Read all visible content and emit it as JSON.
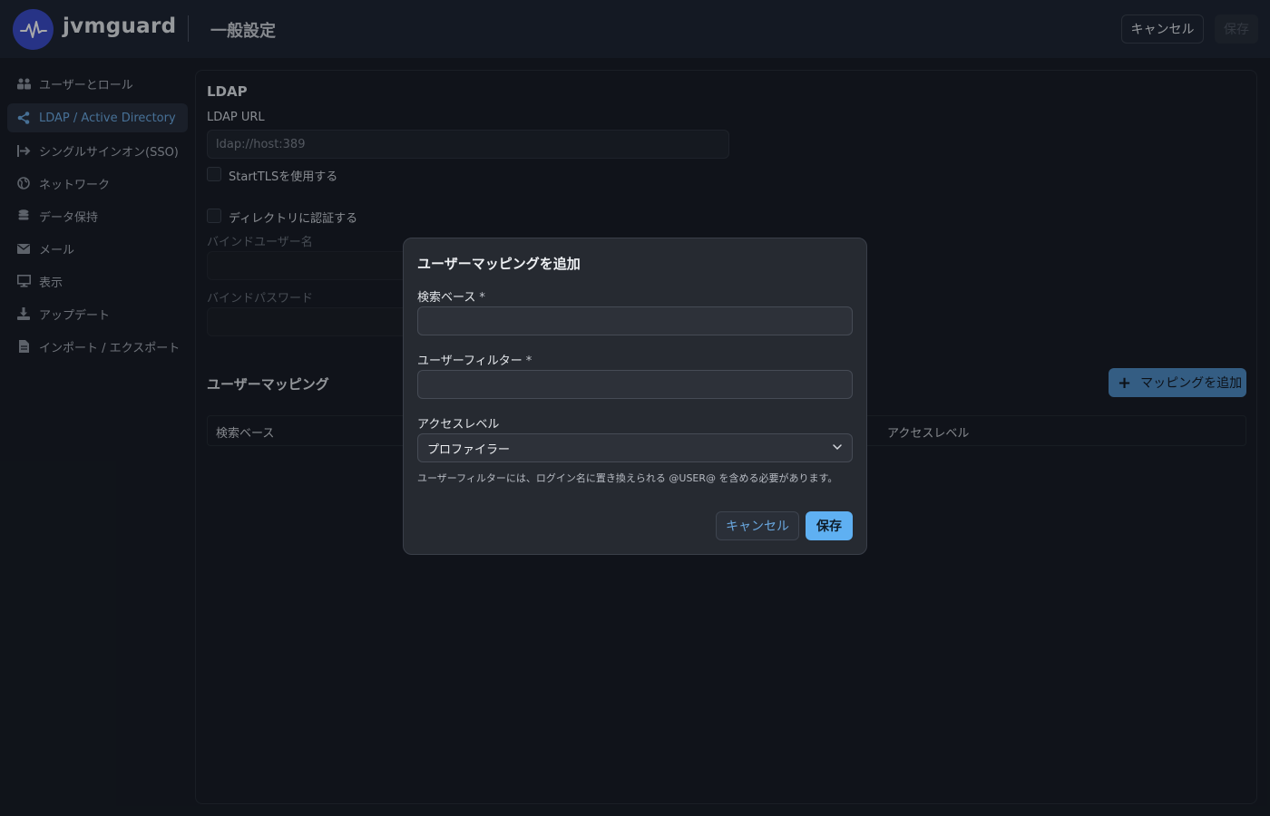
{
  "header": {
    "brand": "jvmguard",
    "page_title": "一般設定",
    "cancel_label": "キャンセル",
    "save_label": "保存"
  },
  "sidebar": {
    "items": [
      {
        "label": "ユーザーとロール",
        "icon": "users-icon",
        "active": false
      },
      {
        "label": "LDAP / Active Directory",
        "icon": "share-icon",
        "active": true
      },
      {
        "label": "シングルサインオン(SSO)",
        "icon": "sign-in-icon",
        "active": false
      },
      {
        "label": "ネットワーク",
        "icon": "globe-icon",
        "active": false
      },
      {
        "label": "データ保持",
        "icon": "database-icon",
        "active": false
      },
      {
        "label": "メール",
        "icon": "envelope-icon",
        "active": false
      },
      {
        "label": "表示",
        "icon": "monitor-icon",
        "active": false
      },
      {
        "label": "アップデート",
        "icon": "download-icon",
        "active": false
      },
      {
        "label": "インポート / エクスポート",
        "icon": "file-icon",
        "active": false
      }
    ]
  },
  "ldap": {
    "section_title": "LDAP",
    "url_label": "LDAP URL",
    "url_placeholder": "ldap://host:389",
    "starttls_label": "StartTLSを使用する",
    "auth_label": "ディレクトリに認証する",
    "bind_user_label": "バインドユーザー名",
    "bind_password_label": "バインドパスワード"
  },
  "mapping": {
    "title": "ユーザーマッピング",
    "add_button": "マッピングを追加",
    "columns": [
      "検索ベース",
      "アクセスレベル"
    ]
  },
  "modal": {
    "title": "ユーザーマッピングを追加",
    "search_base_label": "検索ベース",
    "user_filter_label": "ユーザーフィルター",
    "required_mark": "*",
    "access_level_label": "アクセスレベル",
    "access_level_value": "プロファイラー",
    "hint": "ユーザーフィルターには、ログイン名に置き換えられる @USER@ を含める必要があります。",
    "cancel_label": "キャンセル",
    "save_label": "保存"
  },
  "colors": {
    "accent": "#6aa8e0",
    "primary_button": "#5fb0f2",
    "logo_bg": "#3a4ac8"
  }
}
